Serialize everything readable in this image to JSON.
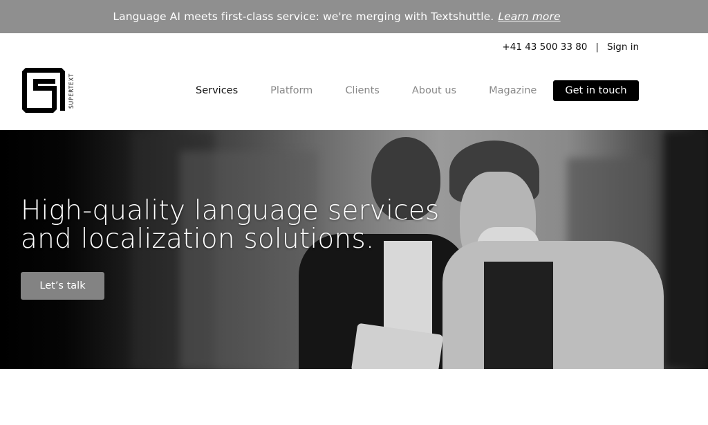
{
  "announcement": {
    "message": "Language AI meets first-class service: we're merging with Textshuttle.",
    "link_label": "Learn more"
  },
  "topbar": {
    "phone": "+41 43 500 33 80",
    "separator": "|",
    "sign_in": "Sign in"
  },
  "brand": {
    "name": "SUPERTEXT",
    "logo_icon": "supertext-s-logo"
  },
  "nav": {
    "items": [
      {
        "label": "Services",
        "active": true
      },
      {
        "label": "Platform",
        "active": false
      },
      {
        "label": "Clients",
        "active": false
      },
      {
        "label": "About us",
        "active": false
      },
      {
        "label": "Magazine",
        "active": false
      }
    ],
    "cta_label": "Get in touch"
  },
  "hero": {
    "title_line1": "High-quality language services",
    "title_line2": "and localization solutions.",
    "button_label": "Let’s talk",
    "image_description": "Black-and-white photo of two people looking at a tablet"
  },
  "colors": {
    "announcement_bg": "#8f8f8f",
    "cta_bg": "#000000",
    "nav_active": "#111111",
    "nav_inactive": "#888888",
    "hero_button_bg": "#838383"
  }
}
